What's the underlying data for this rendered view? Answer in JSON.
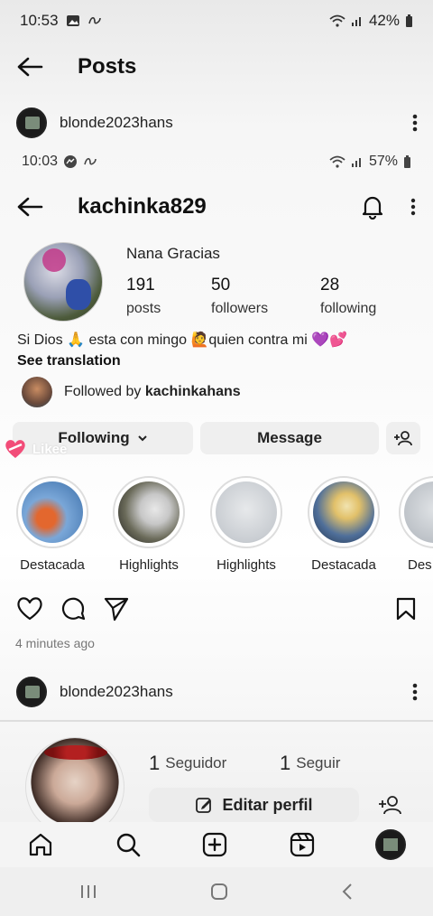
{
  "status_outer": {
    "time": "10:53",
    "battery": "42%"
  },
  "header": {
    "title": "Posts"
  },
  "post1": {
    "username": "blonde2023hans"
  },
  "status_inner": {
    "time": "10:03",
    "battery": "57%"
  },
  "profile": {
    "username": "kachinka829",
    "name": "Nana Gracias",
    "stats": [
      {
        "value": "191",
        "label": "posts"
      },
      {
        "value": "50",
        "label": "followers"
      },
      {
        "value": "28",
        "label": "following"
      }
    ],
    "bio": "Si Dios 🙏 esta con mingo 🙋quien contra mi 💜💕",
    "see_translation": "See translation",
    "followed_prefix": "Followed by ",
    "followed_user": "kachinkahans",
    "buttons": {
      "following": "Following",
      "message": "Message"
    }
  },
  "watermark": "Likee",
  "highlights": [
    {
      "label": "Destacada",
      "color": "#7aa7d8"
    },
    {
      "label": "Highlights",
      "color": "#6b6b5a"
    },
    {
      "label": "Highlights",
      "color": "#c9cdd2"
    },
    {
      "label": "Destacada",
      "color": "#4f6f9a"
    },
    {
      "label": "Des",
      "color": "#b9bec4"
    }
  ],
  "post_time": "4 minutes ago",
  "post2": {
    "username": "blonde2023hans"
  },
  "bottom_profile": {
    "followers_num": "1",
    "followers_label": "Seguidor",
    "following_num": "1",
    "following_label": "Seguir",
    "edit_label": "Editar perfil"
  },
  "icons": [
    "back-arrow-icon",
    "more-icon",
    "bell-icon",
    "heart-icon",
    "comment-icon",
    "share-icon",
    "bookmark-icon",
    "home-icon",
    "search-icon",
    "add-icon",
    "reels-icon"
  ]
}
